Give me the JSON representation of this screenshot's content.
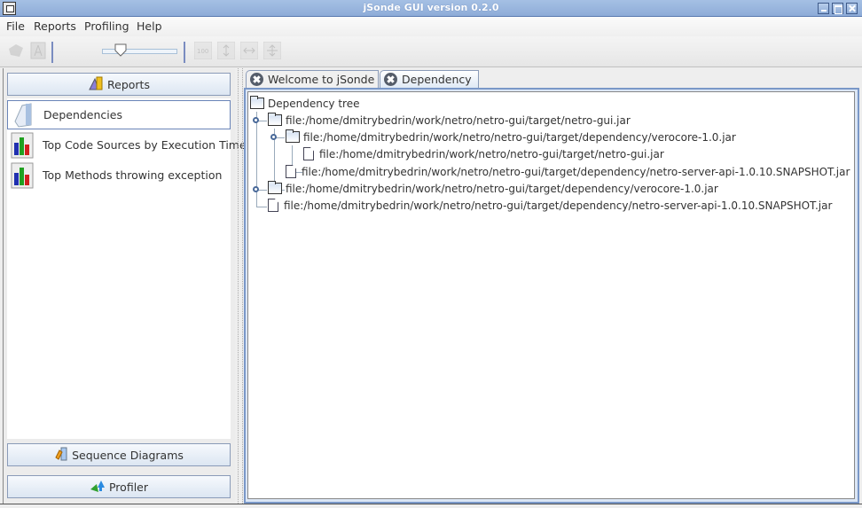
{
  "window": {
    "title": "jSonde GUI version 0.2.0"
  },
  "menu": {
    "items": [
      "File",
      "Reports",
      "Profiling",
      "Help"
    ]
  },
  "toolbar": {
    "buttons": [
      "open-icon",
      "pdf-icon",
      "zoom-100-icon",
      "fit-height-icon",
      "fit-width-icon",
      "move-icon"
    ],
    "zoom_slider_value": 0.25
  },
  "left_panel": {
    "reports_label": "Reports",
    "items": [
      {
        "label": "Dependencies",
        "icon": "folder-icon",
        "selected": true
      },
      {
        "label": "Top Code Sources by Execution Time",
        "icon": "bar-chart-icon",
        "selected": false
      },
      {
        "label": "Top Methods throwing exception",
        "icon": "bar-chart-icon",
        "selected": false
      }
    ],
    "sequence_diagrams_label": "Sequence Diagrams",
    "profiler_label": "Profiler"
  },
  "tabs": [
    {
      "label": "Welcome to jSonde",
      "active": false
    },
    {
      "label": "Dependency",
      "active": true
    }
  ],
  "tree": {
    "root": "Dependency tree",
    "nodes": [
      {
        "label": "file:/home/dmitrybedrin/work/netro/netro-gui/target/netro-gui.jar",
        "type": "folder",
        "depth": 1
      },
      {
        "label": "file:/home/dmitrybedrin/work/netro/netro-gui/target/dependency/verocore-1.0.jar",
        "type": "folder",
        "depth": 2
      },
      {
        "label": "file:/home/dmitrybedrin/work/netro/netro-gui/target/netro-gui.jar",
        "type": "file",
        "depth": 3
      },
      {
        "label": "file:/home/dmitrybedrin/work/netro/netro-gui/target/dependency/netro-server-api-1.0.10.SNAPSHOT.jar",
        "type": "file",
        "depth": 2
      },
      {
        "label": "file:/home/dmitrybedrin/work/netro/netro-gui/target/dependency/verocore-1.0.jar",
        "type": "folder",
        "depth": 1
      },
      {
        "label": "file:/home/dmitrybedrin/work/netro/netro-gui/target/dependency/netro-server-api-1.0.10.SNAPSHOT.jar",
        "type": "file",
        "depth": 1
      }
    ]
  }
}
